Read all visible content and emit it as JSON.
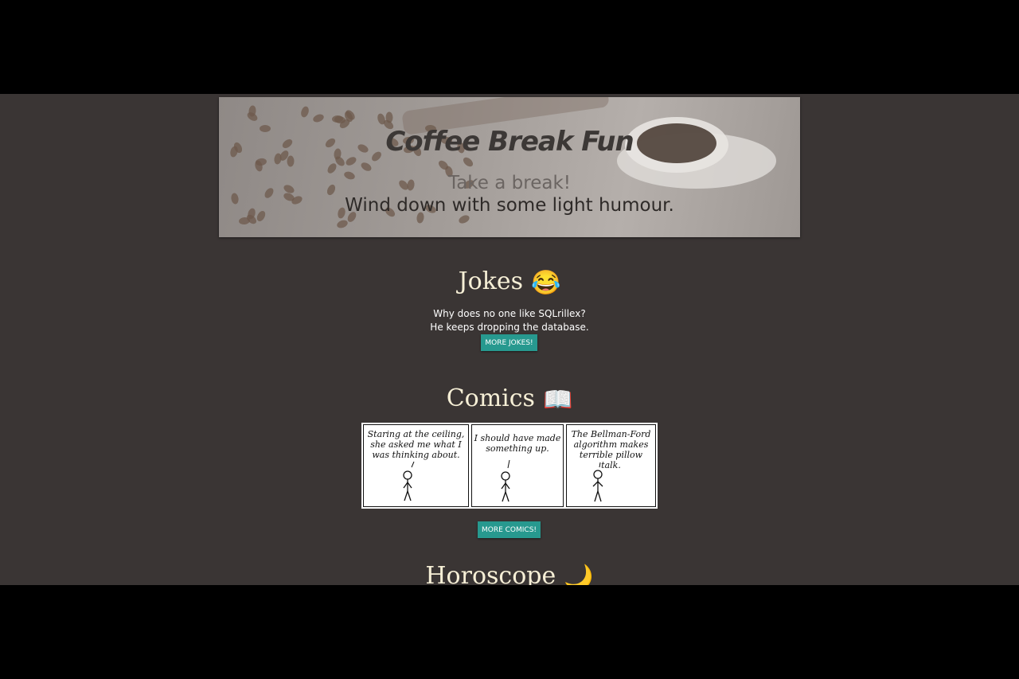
{
  "hero": {
    "title": "Coffee Break Fun",
    "subtitle_line1": "Take a break!",
    "subtitle_line2": "Wind down with some light humour."
  },
  "jokes": {
    "heading": "Jokes",
    "emoji": "😂",
    "setup": "Why does no one like SQLrillex?",
    "punchline": "He keeps dropping the database.",
    "button_label": "MORE JOKES!"
  },
  "comics": {
    "heading": "Comics",
    "emoji": "📖",
    "panels": [
      {
        "text": "Staring at the ceiling, she asked me what I was thinking about."
      },
      {
        "text": "I should have made something up."
      },
      {
        "text": "The Bellman-Ford algorithm makes terrible pillow talk."
      }
    ],
    "button_label": "MORE COMICS!"
  },
  "horoscope": {
    "heading": "Horoscope",
    "emoji": "🌙"
  },
  "colors": {
    "page_background": "#3a3534",
    "heading_text": "#f6efd6",
    "button": "#27998f"
  }
}
